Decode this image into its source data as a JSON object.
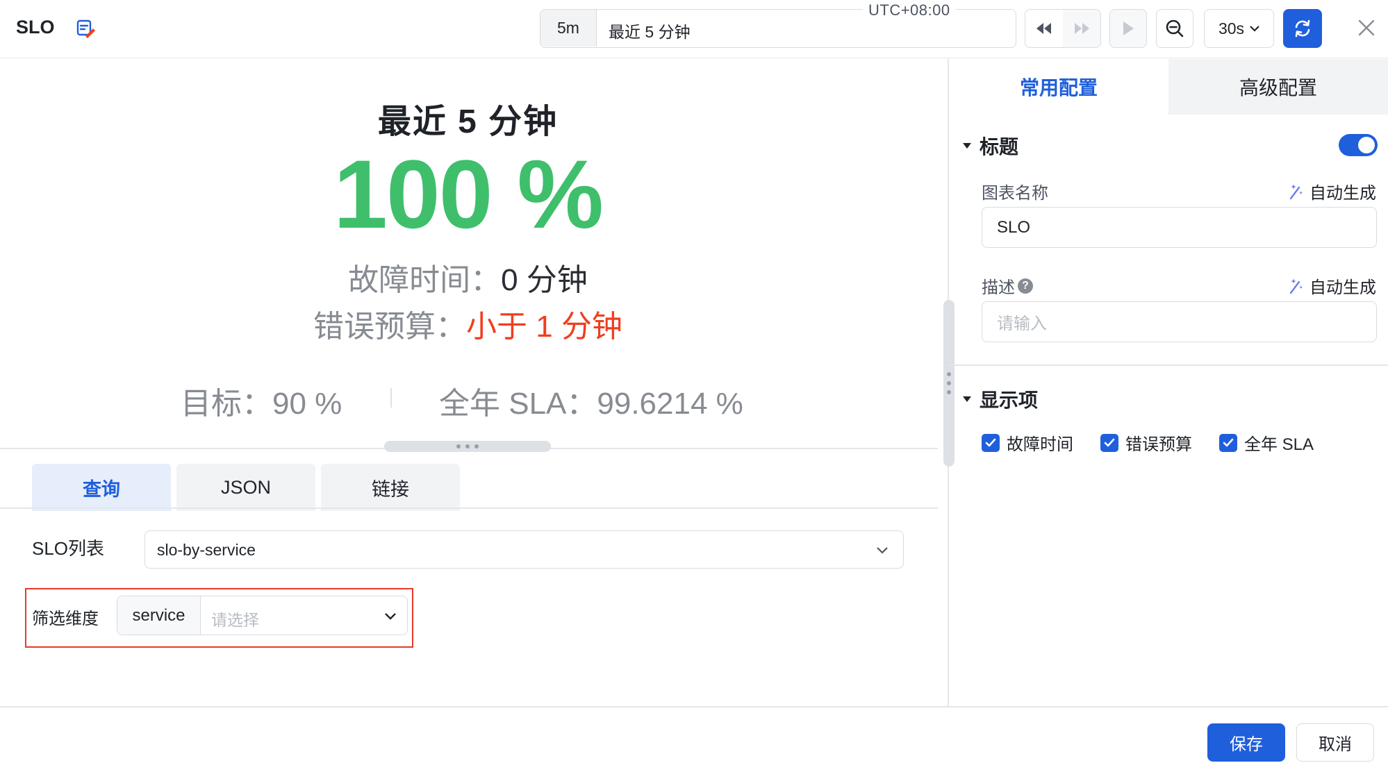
{
  "header": {
    "title": "SLO",
    "title_icon": "dashboard-edit-icon",
    "time_range": {
      "short": "5m",
      "label": "最近 5 分钟",
      "timezone": "UTC+08:00"
    },
    "refresh_interval": "30s",
    "icons": [
      "rewind-icon",
      "fast-forward-icon",
      "play-icon",
      "zoom-out-icon",
      "chevron-down-icon",
      "refresh-icon",
      "close-icon"
    ],
    "accent_color": "#1f5fdc"
  },
  "preview": {
    "period": "最近 5 分钟",
    "value": "100 %",
    "value_color": "#3fbf6b",
    "downtime_label": "故障时间：",
    "downtime_value": "0 分钟",
    "budget_label": "错误预算：",
    "budget_value": "小于 1 分钟",
    "budget_color": "#ef3f1f",
    "target_label": "目标：",
    "target_value": "90 %",
    "annual_label": "全年 SLA：",
    "annual_value": "99.6214 %"
  },
  "query": {
    "tabs": [
      "查询",
      "JSON",
      "链接"
    ],
    "active_tab": "查询",
    "slo_list_label": "SLO列表",
    "slo_list_value": "slo-by-service",
    "filter_label": "筛选维度",
    "filter_key": "service",
    "filter_placeholder": "请选择",
    "highlight_color": "#e8392a"
  },
  "config": {
    "tabs": [
      "常用配置",
      "高级配置"
    ],
    "active_tab": "常用配置",
    "title_section": {
      "heading": "标题",
      "enabled": true,
      "name_label": "图表名称",
      "auto_generate": "自动生成",
      "name_value": "SLO",
      "desc_label": "描述",
      "desc_placeholder": "请输入"
    },
    "display_section": {
      "heading": "显示项",
      "items": [
        {
          "label": "故障时间",
          "checked": true
        },
        {
          "label": "错误预算",
          "checked": true
        },
        {
          "label": "全年 SLA",
          "checked": true
        }
      ]
    }
  },
  "footer": {
    "save": "保存",
    "cancel": "取消"
  }
}
